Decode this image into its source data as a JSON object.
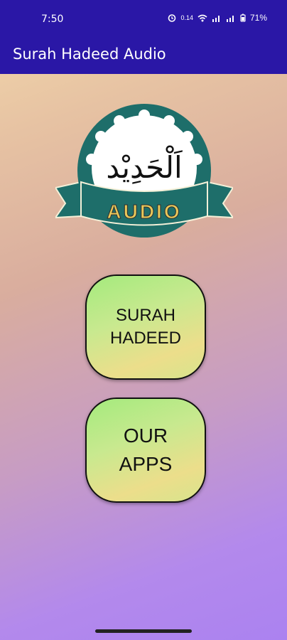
{
  "statusbar": {
    "time": "7:50",
    "icons": [
      "alarm-icon",
      "signal-icon",
      "wifi-icon",
      "cell-signal-icon",
      "battery-icon"
    ],
    "battery_label": "71%",
    "data_label": "0.14"
  },
  "appbar": {
    "title": "Surah Hadeed Audio"
  },
  "logo": {
    "arabic": "اَلْحَدِيْد",
    "banner_text": "AUDIO",
    "colors": {
      "teal": "#1e6e6a",
      "white": "#ffffff"
    }
  },
  "buttons": [
    {
      "line1": "SURAH",
      "line2": "HADEED"
    },
    {
      "line1": "OUR",
      "line2": "APPS"
    }
  ],
  "colors": {
    "appbar": "#2a17a6"
  }
}
